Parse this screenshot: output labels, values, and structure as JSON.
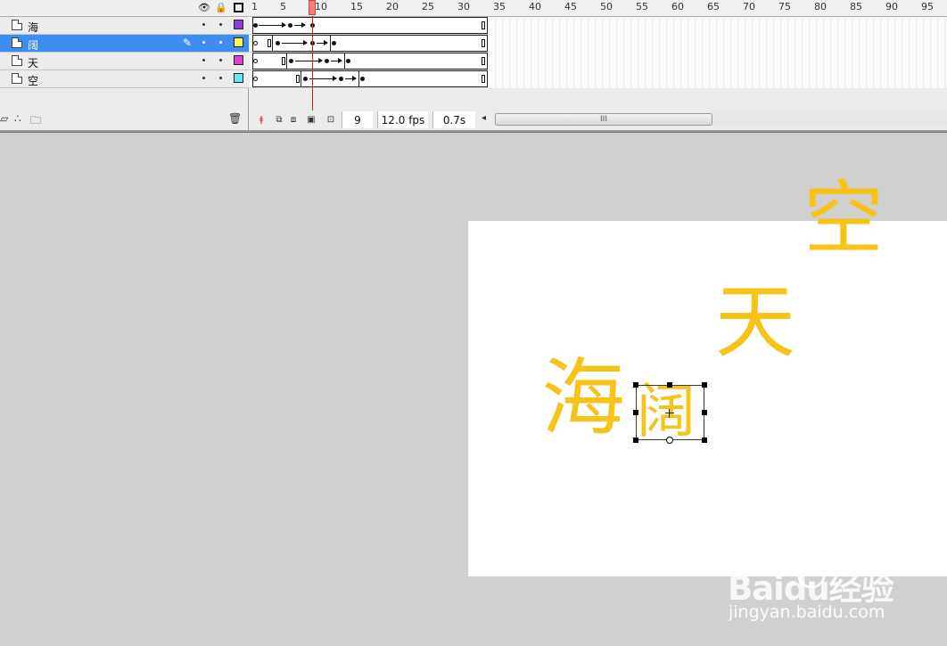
{
  "timeline": {
    "layers": [
      {
        "name": "海",
        "color": "#8a3fd6",
        "selected": false
      },
      {
        "name": "阔",
        "color": "#f7f45a",
        "selected": true
      },
      {
        "name": "天",
        "color": "#e23fd8",
        "selected": false
      },
      {
        "name": "空",
        "color": "#5fe8f0",
        "selected": false
      }
    ],
    "header_icons": [
      "eye-icon",
      "lock-icon",
      "outline-icon"
    ],
    "ruler_labels": [
      "1",
      "5",
      "10",
      "15",
      "20",
      "25",
      "30",
      "35",
      "40",
      "45",
      "50",
      "55",
      "60",
      "65",
      "70",
      "75",
      "80",
      "85",
      "90",
      "95"
    ],
    "current_frame": "9",
    "frame_rate": "12.0 fps",
    "elapsed_time": "0.7s",
    "scroll_grip": "III"
  },
  "stage": {
    "glyphs": {
      "hai": "海",
      "kuo": "阔",
      "tian": "天",
      "kong": "空"
    },
    "text_color": "#f6c419"
  },
  "watermark": {
    "logo": "Baidu经验",
    "url": "jingyan.baidu.com"
  }
}
